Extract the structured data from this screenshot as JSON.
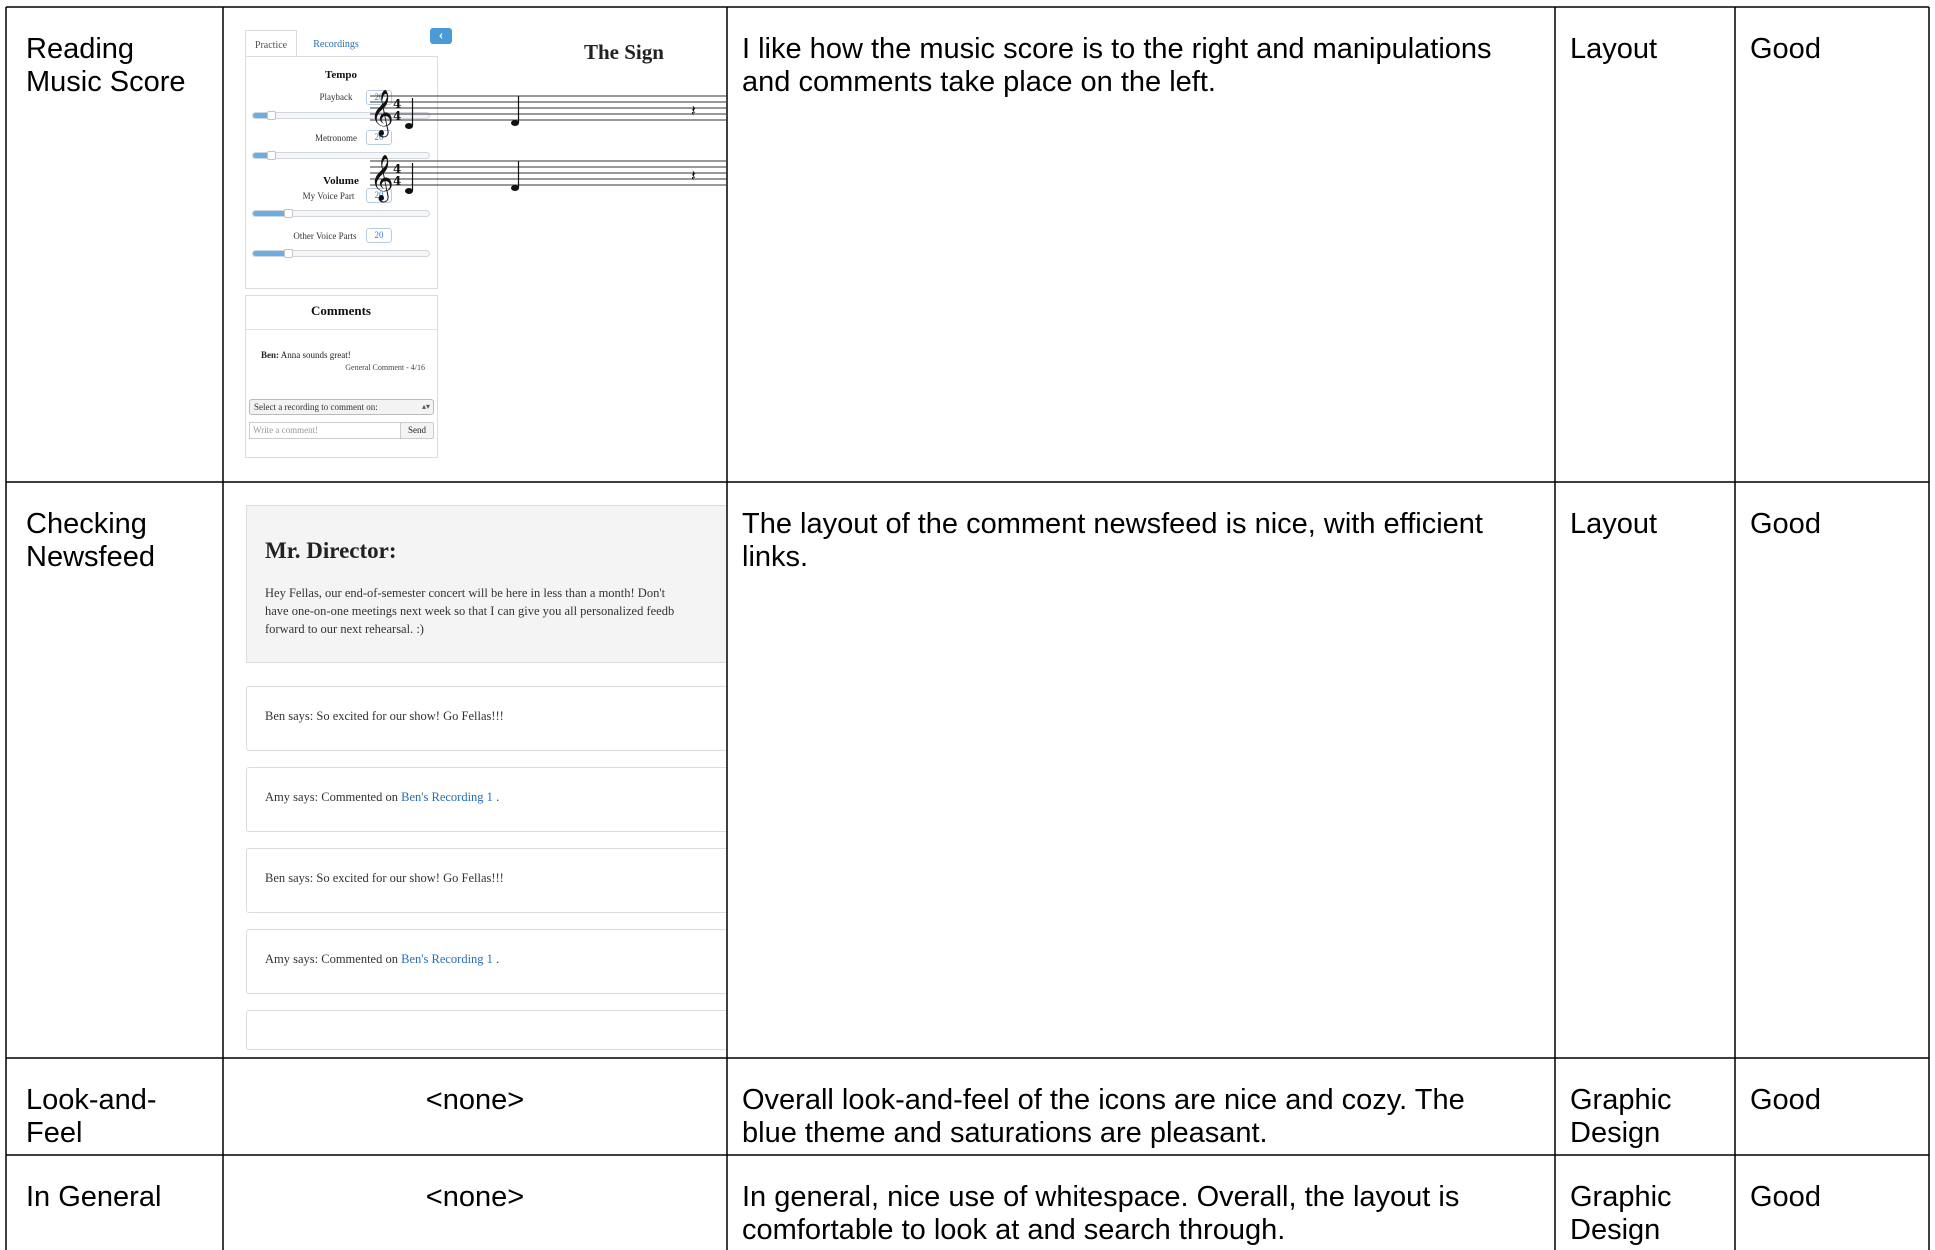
{
  "rows": [
    {
      "task": "Reading\nMusic Score",
      "screenshot": "music-score-panel",
      "comment": "I like how the music score is to the right and manipulations and comments take place on the left.",
      "category": "Layout",
      "rating": "Good"
    },
    {
      "task": "Checking\nNewsfeed",
      "screenshot": "newsfeed-panel",
      "comment": "The layout of the comment newsfeed is nice, with efficient links.",
      "category": "Layout",
      "rating": "Good"
    },
    {
      "task": "Look-and-\nFeel",
      "screenshot": "<none>",
      "comment": "Overall look-and-feel of the icons are nice and cozy.  The blue theme and saturations are pleasant.",
      "category": "Graphic\nDesign",
      "rating": "Good"
    },
    {
      "task": "In General",
      "screenshot": "<none>",
      "comment": "In general, nice use of whitespace.  Overall, the layout is comfortable to look at and search through.",
      "category": "Graphic\nDesign",
      "rating": "Good"
    }
  ],
  "score_ui": {
    "tabs": [
      "Practice",
      "Recordings"
    ],
    "tempo": {
      "heading": "Tempo",
      "sliders": [
        {
          "label": "Playback",
          "value": "20",
          "level": 0.1
        },
        {
          "label": "Metronome",
          "value": "20",
          "level": 0.1
        }
      ]
    },
    "volume": {
      "heading": "Volume",
      "sliders": [
        {
          "label": "My Voice Part",
          "value": "20",
          "level": 0.2
        },
        {
          "label": "Other Voice Parts",
          "value": "20",
          "level": 0.2
        }
      ]
    },
    "comments": {
      "heading": "Comments",
      "author": "Ben:",
      "text": "Anna sounds great!",
      "meta": "General Comment - 4/16",
      "select_placeholder": "Select a recording to comment on:",
      "input_placeholder": "Write a comment!",
      "send_label": "Send"
    },
    "collapse_icon": "chevron-left-icon",
    "score_title": "The Sign",
    "accent_color": "#4a9ad6"
  },
  "newsfeed_ui": {
    "announcement": {
      "title": "Mr. Director:",
      "lines": [
        "Hey Fellas, our end-of-semester concert will be here in less than a month! Don't",
        "have one-on-one meetings next week so that I can give you all personalized feedb",
        "forward to our next rehearsal. :)"
      ]
    },
    "items": [
      {
        "text": "Ben says: So excited for our show! Go Fellas!!!",
        "link": "",
        "after": ""
      },
      {
        "text": "Amy says: Commented on ",
        "link": "Ben's Recording 1",
        "after": " ."
      },
      {
        "text": "Ben says: So excited for our show! Go Fellas!!!",
        "link": "",
        "after": ""
      },
      {
        "text": "Amy says: Commented on ",
        "link": "Ben's Recording 1",
        "after": " ."
      }
    ],
    "link_color": "#2a6db8"
  }
}
